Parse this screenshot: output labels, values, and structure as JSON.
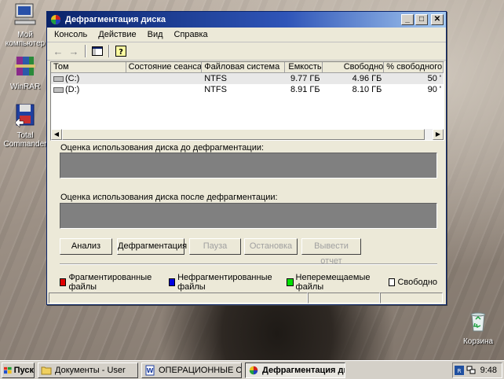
{
  "desktop": {
    "icons": [
      {
        "label": "Мой компьютер",
        "icon": "my-computer-icon"
      },
      {
        "label": "WinRAR",
        "icon": "winrar-icon"
      },
      {
        "label": "Total Commander",
        "icon": "total-commander-icon"
      },
      {
        "label": "Корзина",
        "icon": "recycle-bin-icon"
      }
    ]
  },
  "window": {
    "title": "Дефрагментация диска",
    "menu": [
      "Консоль",
      "Действие",
      "Вид",
      "Справка"
    ],
    "columns": [
      "Том",
      "Состояние сеанса",
      "Файловая система",
      "Емкость",
      "Свободно",
      "% свободного мест"
    ],
    "volumes": [
      {
        "name": "(C:)",
        "status": "",
        "fs": "NTFS",
        "capacity": "9.77 ГБ",
        "free": "4.96 ГБ",
        "free_pct": "50 '"
      },
      {
        "name": "(D:)",
        "status": "",
        "fs": "NTFS",
        "capacity": "8.91 ГБ",
        "free": "8.10 ГБ",
        "free_pct": "90 '"
      }
    ],
    "before_label": "Оценка использования диска до дефрагментации:",
    "after_label": "Оценка использования диска после дефрагментации:",
    "buttons": {
      "analyze": "Анализ",
      "defrag": "Дефрагментация",
      "pause": "Пауза",
      "stop": "Остановка",
      "report": "Вывести отчет"
    },
    "legend": [
      {
        "label": "Фрагментированные файлы",
        "color": "#e00000"
      },
      {
        "label": "Нефрагментированные файлы",
        "color": "#0000e0"
      },
      {
        "label": "Неперемещаемые файлы",
        "color": "#00e000"
      },
      {
        "label": "Свободно",
        "color": "#ffffff"
      }
    ]
  },
  "taskbar": {
    "start": "Пуск",
    "tasks": [
      "Документы - User",
      "ОПЕРАЦИОННЫЕ СИСТ...",
      "Дефрагментация ди..."
    ],
    "clock": "9:48"
  }
}
